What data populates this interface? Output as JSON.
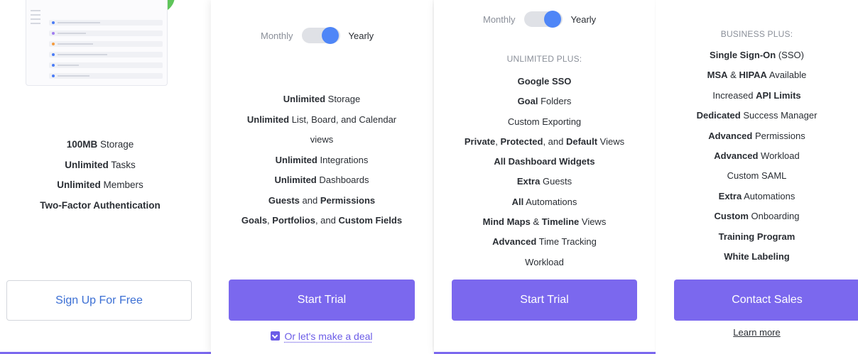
{
  "accent_color": "#7b68ee",
  "free": {
    "features": [
      {
        "strong": "100MB",
        "rest": " Storage"
      },
      {
        "strong": "Unlimited",
        "rest": " Tasks"
      },
      {
        "strong": "Unlimited",
        "rest": " Members"
      },
      {
        "strong": "Two-Factor Authentication",
        "rest": ""
      }
    ],
    "button": "Sign Up For Free"
  },
  "unlimited": {
    "toggle": {
      "off": "Monthly",
      "on": "Yearly"
    },
    "features": [
      {
        "strong": "Unlimited",
        "rest": " Storage"
      },
      {
        "strong": "Unlimited",
        "rest": " List, Board, and Calendar"
      },
      {
        "strong": "",
        "rest": "views"
      },
      {
        "strong": "Unlimited",
        "rest": " Integrations"
      },
      {
        "strong": "Unlimited",
        "rest": " Dashboards"
      },
      {
        "parts": [
          {
            "b": "Guests"
          },
          {
            "t": " and "
          },
          {
            "b": "Permissions"
          }
        ]
      },
      {
        "parts": [
          {
            "b": "Goals"
          },
          {
            "t": ", "
          },
          {
            "b": "Portfolios"
          },
          {
            "t": ", and "
          },
          {
            "b": "Custom Fields"
          }
        ]
      }
    ],
    "button": "Start Trial",
    "deal_link": "Or let's make a deal"
  },
  "business": {
    "toggle": {
      "off": "Monthly",
      "on": "Yearly"
    },
    "heading": "UNLIMITED PLUS:",
    "features": [
      {
        "parts": [
          {
            "b": "Google SSO"
          }
        ]
      },
      {
        "parts": [
          {
            "b": "Goal"
          },
          {
            "t": " Folders"
          }
        ]
      },
      {
        "parts": [
          {
            "t": "Custom Exporting"
          }
        ]
      },
      {
        "parts": [
          {
            "b": "Private"
          },
          {
            "t": ", "
          },
          {
            "b": "Protected"
          },
          {
            "t": ", and "
          },
          {
            "b": "Default"
          },
          {
            "t": " Views"
          }
        ]
      },
      {
        "parts": [
          {
            "b": "All Dashboard Widgets"
          }
        ]
      },
      {
        "parts": [
          {
            "b": "Extra"
          },
          {
            "t": " Guests"
          }
        ]
      },
      {
        "parts": [
          {
            "b": "All"
          },
          {
            "t": " Automations"
          }
        ]
      },
      {
        "parts": [
          {
            "b": "Mind Maps"
          },
          {
            "t": " & "
          },
          {
            "b": "Timeline"
          },
          {
            "t": " Views"
          }
        ]
      },
      {
        "parts": [
          {
            "b": "Advanced"
          },
          {
            "t": " Time Tracking"
          }
        ]
      },
      {
        "parts": [
          {
            "t": "Workload"
          }
        ]
      }
    ],
    "button": "Start Trial"
  },
  "enterprise": {
    "heading": "BUSINESS PLUS:",
    "features": [
      {
        "parts": [
          {
            "b": "Single Sign-On"
          },
          {
            "t": " (SSO)"
          }
        ]
      },
      {
        "parts": [
          {
            "b": "MSA"
          },
          {
            "t": " & "
          },
          {
            "b": "HIPAA"
          },
          {
            "t": " Available"
          }
        ]
      },
      {
        "parts": [
          {
            "t": "Increased "
          },
          {
            "b": "API Limits"
          }
        ]
      },
      {
        "parts": [
          {
            "b": "Dedicated"
          },
          {
            "t": " Success Manager"
          }
        ]
      },
      {
        "parts": [
          {
            "b": "Advanced"
          },
          {
            "t": " Permissions"
          }
        ]
      },
      {
        "parts": [
          {
            "b": "Advanced"
          },
          {
            "t": " Workload"
          }
        ]
      },
      {
        "parts": [
          {
            "t": "Custom SAML"
          }
        ]
      },
      {
        "parts": [
          {
            "b": "Extra"
          },
          {
            "t": " Automations"
          }
        ]
      },
      {
        "parts": [
          {
            "b": "Custom"
          },
          {
            "t": " Onboarding"
          }
        ]
      },
      {
        "parts": [
          {
            "b": "Training Program"
          }
        ]
      },
      {
        "parts": [
          {
            "b": "White Labeling"
          }
        ]
      }
    ],
    "button": "Contact Sales",
    "learn_more": "Learn more"
  }
}
